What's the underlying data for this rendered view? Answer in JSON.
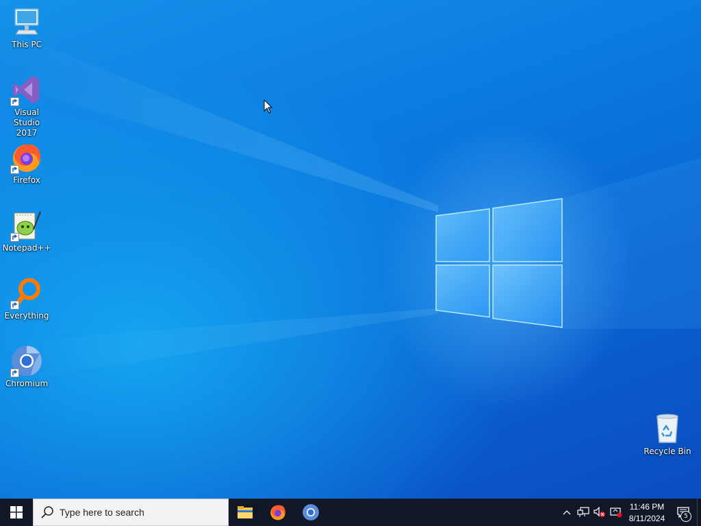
{
  "desktop": {
    "icons": [
      {
        "label": "This PC",
        "icon": "this-pc-icon"
      },
      {
        "label": "Visual Studio\n2017",
        "icon": "visual-studio-icon"
      },
      {
        "label": "Firefox",
        "icon": "firefox-icon"
      },
      {
        "label": "Notepad++",
        "icon": "notepadpp-icon"
      },
      {
        "label": "Everything",
        "icon": "everything-icon"
      },
      {
        "label": "Chromium",
        "icon": "chromium-icon"
      },
      {
        "label": "Recycle Bin",
        "icon": "recycle-bin-icon"
      }
    ]
  },
  "taskbar": {
    "start_icon": "windows-logo-icon",
    "search": {
      "placeholder": "Type here to search",
      "icon": "search-icon"
    },
    "pinned": [
      {
        "name": "File Explorer",
        "icon": "file-explorer-icon"
      },
      {
        "name": "Firefox",
        "icon": "firefox-icon"
      },
      {
        "name": "Chromium",
        "icon": "chromium-icon"
      }
    ],
    "tray": {
      "icons": [
        "chevron-up-icon",
        "network-icon",
        "volume-muted-icon",
        "security-alert-icon"
      ],
      "time": "11:46 PM",
      "date": "8/11/2024",
      "notification_count": "5"
    }
  },
  "colors": {
    "wallpaper_blue": "#0a6fd6",
    "taskbar": "#101828",
    "search_bg": "#f3f3f3"
  }
}
